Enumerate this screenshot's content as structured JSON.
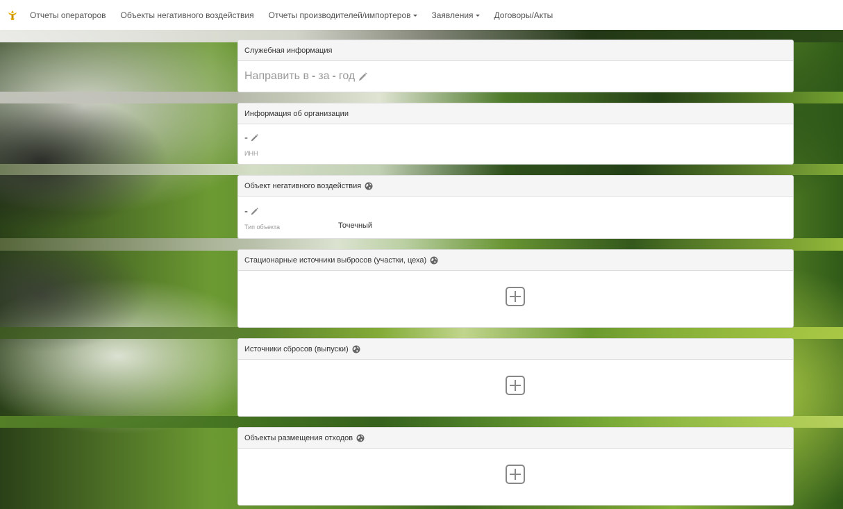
{
  "nav": {
    "items": [
      {
        "label": "Отчеты операторов",
        "dropdown": false
      },
      {
        "label": "Объекты негативного воздействия",
        "dropdown": false
      },
      {
        "label": "Отчеты производителей/импортеров",
        "dropdown": true
      },
      {
        "label": "Заявления",
        "dropdown": true
      },
      {
        "label": "Договоры/Акты",
        "dropdown": false
      }
    ]
  },
  "service_info": {
    "title": "Служебная информация",
    "line": {
      "prefix": "Направить в",
      "sep1": "-",
      "middle": "за",
      "sep2": "-",
      "suffix": "год"
    }
  },
  "org_info": {
    "title": "Информация об организации",
    "name_value": "-",
    "inn_label": "ИНН"
  },
  "nvos_object": {
    "title": "Объект негативного воздействия",
    "name_value": "-",
    "type_label": "Тип объекта",
    "type_value": "Точечный"
  },
  "stationary_sources": {
    "title": "Стационарные источники выбросов (участки, цеха)"
  },
  "discharge_sources": {
    "title": "Источники сбросов (выпуски)"
  },
  "waste_sites": {
    "title": "Объекты размещения отходов"
  },
  "icons": {
    "brand": "emblem-icon",
    "edit": "pencil-icon",
    "info": "globe-icon",
    "add": "plus-square-icon"
  },
  "colors": {
    "panel_heading_bg": "#f5f5f5",
    "panel_border": "#dddddd",
    "muted_text": "#999999",
    "nav_text": "#555555",
    "brand_icon": "#e0a800"
  }
}
